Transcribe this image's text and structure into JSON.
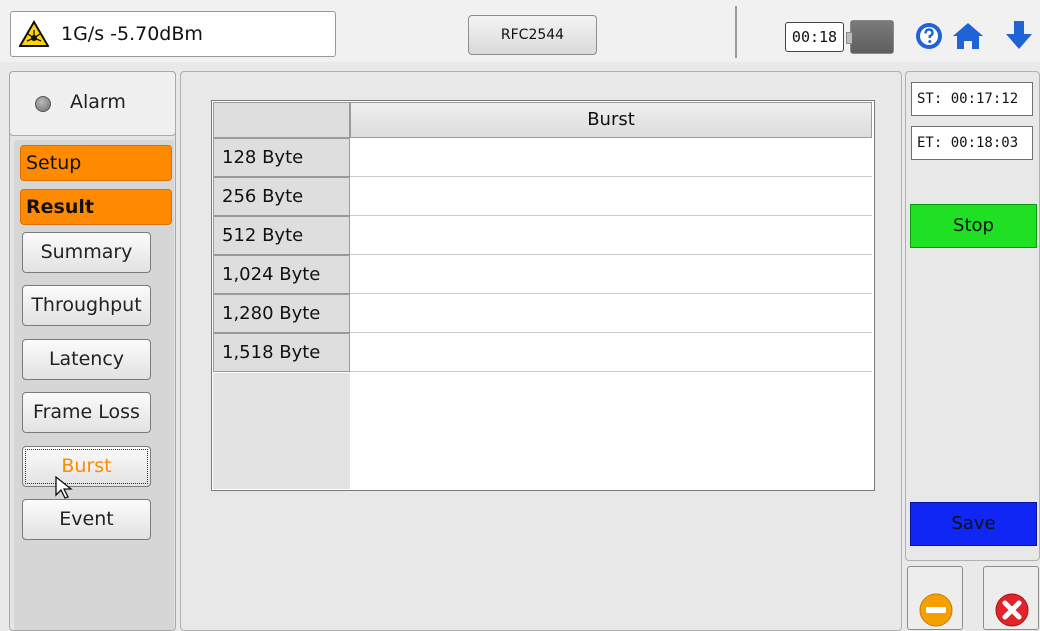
{
  "header": {
    "signal_text": "1G/s -5.70dBm",
    "mode_label": "RFC2544",
    "timer": "00:18"
  },
  "sidebar": {
    "alarm_label": "Alarm",
    "setup_tab": "Setup",
    "result_tab": "Result",
    "items": [
      {
        "label": "Summary"
      },
      {
        "label": "Throughput"
      },
      {
        "label": "Latency"
      },
      {
        "label": "Frame Loss"
      },
      {
        "label": "Burst"
      },
      {
        "label": "Event"
      }
    ],
    "active_item": "Burst"
  },
  "table": {
    "columns": [
      "",
      "Burst"
    ],
    "rows": [
      {
        "label": "128 Byte",
        "value": ""
      },
      {
        "label": "256 Byte",
        "value": ""
      },
      {
        "label": "512 Byte",
        "value": ""
      },
      {
        "label": "1,024 Byte",
        "value": ""
      },
      {
        "label": "1,280 Byte",
        "value": ""
      },
      {
        "label": "1,518 Byte",
        "value": ""
      }
    ]
  },
  "right": {
    "start_time": "ST: 00:17:12",
    "end_time": "ET: 00:18:03",
    "stop_label": "Stop",
    "save_label": "Save"
  },
  "colors": {
    "accent_orange": "#ff8a00",
    "stop_green": "#1fe022",
    "save_blue": "#0f26f5",
    "exit_red": "#e0242a"
  },
  "icons": [
    "warning-laser-icon",
    "help-icon",
    "home-icon",
    "download-arrow-icon",
    "battery-icon",
    "minus-circle-icon",
    "close-circle-icon",
    "mouse-cursor-icon"
  ]
}
